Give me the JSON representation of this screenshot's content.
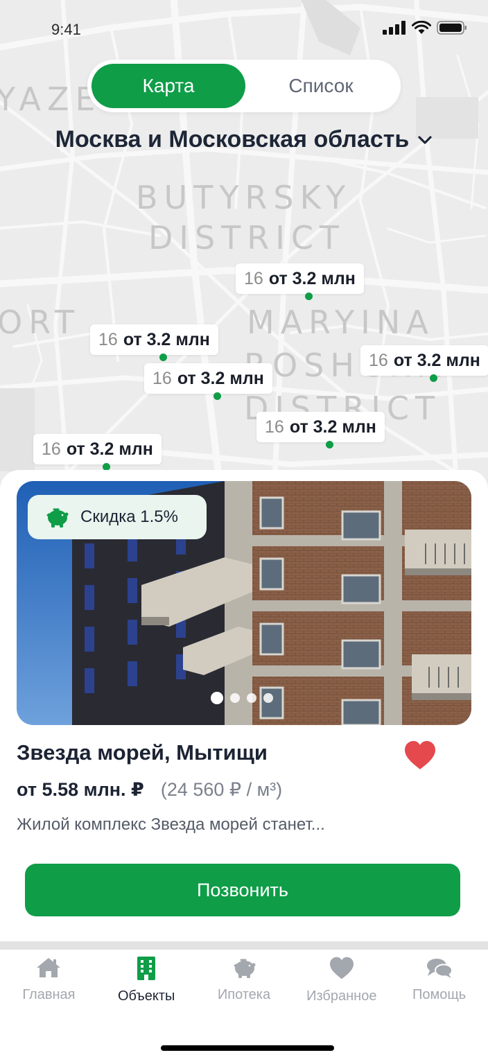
{
  "status_bar": {
    "time": "9:41"
  },
  "view_toggle": {
    "map_label": "Карта",
    "list_label": "Список",
    "selected": "Карта"
  },
  "region": {
    "label": "Москва и Московская область"
  },
  "map": {
    "district_labels": [
      "YAZEVSKY",
      "BUTYRSKY",
      "DISTRICT",
      "ORT",
      "MARYINA",
      "ROSHCHA",
      "DISTRICT"
    ]
  },
  "map_pins": [
    {
      "count": "16",
      "price": "от 3.2 млн"
    },
    {
      "count": "16",
      "price": "от 3.2 млн"
    },
    {
      "count": "16",
      "price": "от 3.2 млн"
    },
    {
      "count": "16",
      "price": "от 3.2 млн"
    },
    {
      "count": "16",
      "price": "от 3.2 млн"
    },
    {
      "count": "16",
      "price": "от 3.2 млн"
    }
  ],
  "listing": {
    "discount": "Скидка 1.5%",
    "title": "Звезда морей, Мытищи",
    "price": "от 5.58 млн. ₽",
    "price_per_m2": "(24 560 ₽ / м³)",
    "description": "Жилой комплекс Звезда морей станет...",
    "photo_count": 4,
    "photo_index": 1,
    "favorite": true,
    "call_button": "Позвонить"
  },
  "tabbar": {
    "items": [
      {
        "label": "Главная",
        "icon": "home-icon",
        "active": false
      },
      {
        "label": "Объекты",
        "icon": "building-icon",
        "active": true
      },
      {
        "label": "Ипотека",
        "icon": "piggy-bank-icon",
        "active": false
      },
      {
        "label": "Избранное",
        "icon": "heart-icon",
        "active": false
      },
      {
        "label": "Помощь",
        "icon": "chat-bubbles-icon",
        "active": false
      }
    ]
  },
  "colors": {
    "accent": "#0f9d48",
    "heart": "#e5484d",
    "discount_bg": "#e9f5ee",
    "map_bg": "#ececec"
  }
}
